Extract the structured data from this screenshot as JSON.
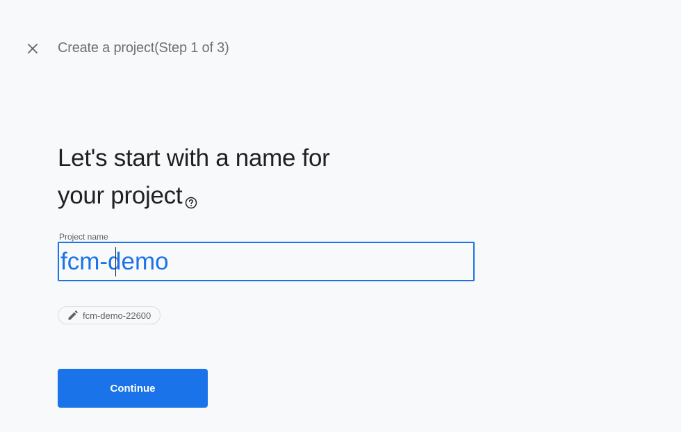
{
  "header": {
    "close_icon": "close-icon",
    "title": "Create a project(Step 1 of 3)"
  },
  "main": {
    "heading_line1": "Let's start with a name for",
    "heading_line2": "your project",
    "help_icon": "help-circle-icon",
    "project_name_label": "Project name",
    "project_name_value": "fcm-demo",
    "project_id_chip": {
      "icon": "pencil-icon",
      "text": "fcm-demo-22600"
    },
    "continue_label": "Continue"
  },
  "colors": {
    "accent": "#1a73e8",
    "background": "#f8f9fa",
    "text_primary": "#202124",
    "text_secondary": "#5f6368"
  }
}
